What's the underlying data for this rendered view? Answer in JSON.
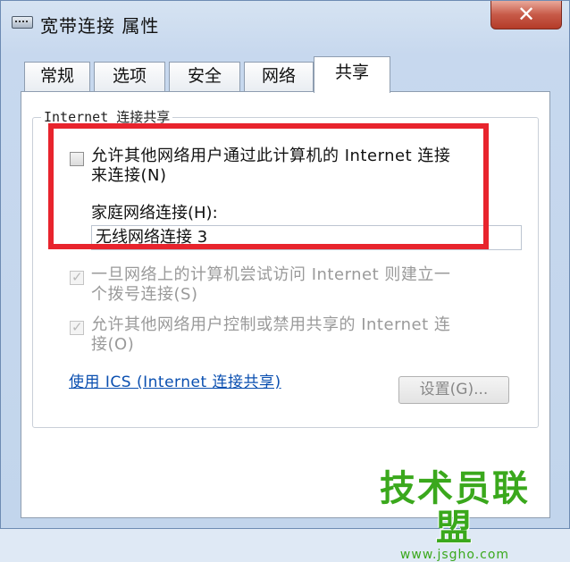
{
  "window": {
    "title": "宽带连接 属性",
    "close_label": "✕"
  },
  "tabs": [
    "常规",
    "选项",
    "安全",
    "网络",
    "共享"
  ],
  "active_tab": "共享",
  "group": {
    "label": "Internet 连接共享",
    "allow_sharing": {
      "checked": false,
      "line1": "允许其他网络用户通过此计算机的 Internet 连接",
      "line2": "来连接(N)"
    },
    "home_network": {
      "label": "家庭网络连接(H):",
      "value": "无线网络连接 3"
    },
    "dial_on_demand": {
      "checked": true,
      "disabled": true,
      "line1": "一旦网络上的计算机尝试访问 Internet 则建立一",
      "line2": "个拨号连接(S)"
    },
    "allow_control": {
      "checked": true,
      "disabled": true,
      "line1": "允许其他网络用户控制或禁用共享的 Internet 连",
      "line2": "接(O)"
    },
    "ics_link": "使用 ICS (Internet 连接共享)",
    "settings_button": "设置(G)..."
  },
  "watermark": {
    "main": "技术员联盟",
    "sub": "www.jsgho.com"
  },
  "colors": {
    "highlight": "#e8242d",
    "link": "#0a4fb0",
    "watermark": "#3aa81c"
  }
}
